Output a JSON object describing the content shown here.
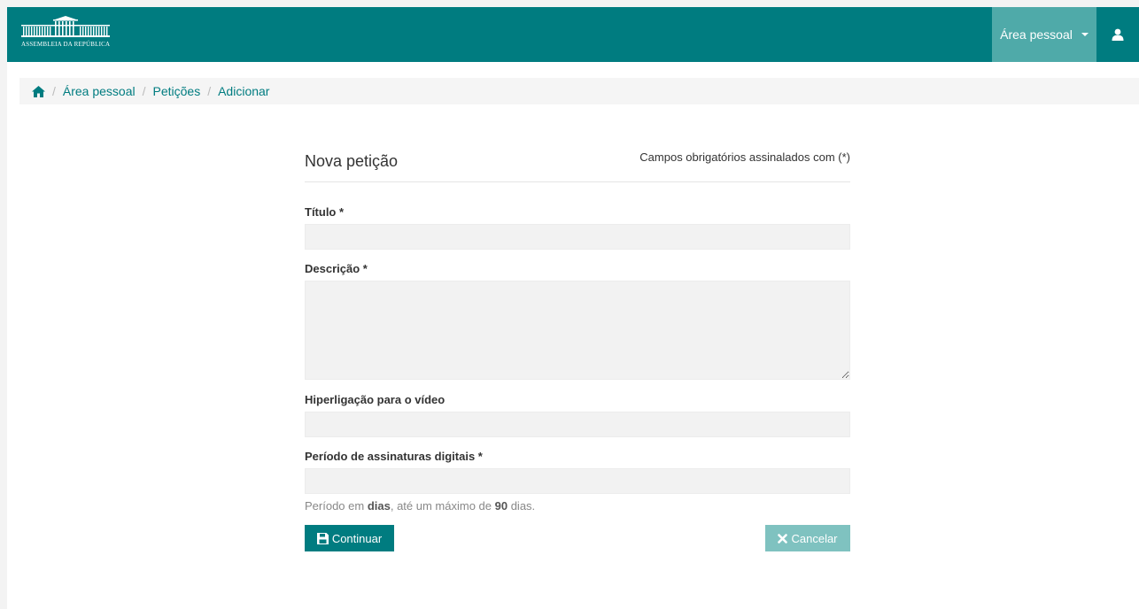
{
  "header": {
    "logo_text": "ASSEMBLEIA DA REPÚBLICA",
    "area_pessoal_label": "Área pessoal"
  },
  "icons": {
    "home": "home-icon",
    "user": "user-icon",
    "caret": "caret-down-icon",
    "save": "floppy-disk-icon",
    "cancel": "close-icon"
  },
  "breadcrumb": {
    "items": [
      "Área pessoal",
      "Petições",
      "Adicionar"
    ],
    "separator": "/"
  },
  "form": {
    "title": "Nova petição",
    "required_note": "Campos obrigatórios assinalados com (*)",
    "fields": {
      "titulo": {
        "label": "Título *",
        "value": ""
      },
      "descricao": {
        "label": "Descrição *",
        "value": ""
      },
      "video": {
        "label": "Hiperligação para o vídeo",
        "value": ""
      },
      "periodo": {
        "label": "Período de assinaturas digitais *",
        "value": ""
      }
    },
    "help": {
      "part1": "Período em ",
      "bold1": "dias",
      "part2": ", até um máximo de ",
      "bold2": "90",
      "part3": " dias."
    },
    "continue_label": "Continuar",
    "cancel_label": "Cancelar"
  },
  "colors": {
    "brand": "#007c80",
    "dropdown_bg": "#4faaa9",
    "cancel_bg": "#7fc2c0"
  }
}
